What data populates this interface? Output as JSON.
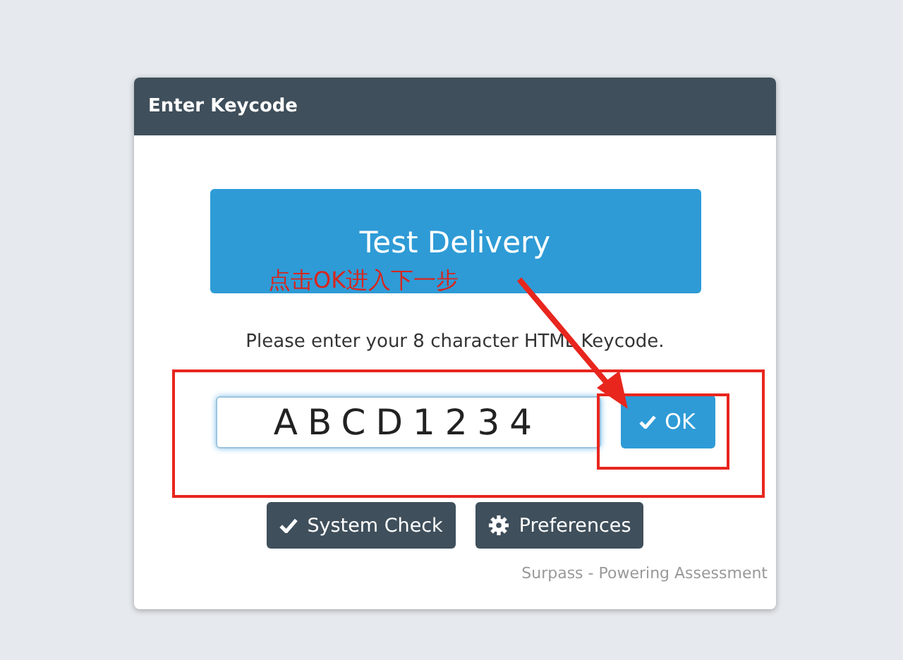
{
  "dialog": {
    "title": "Enter Keycode"
  },
  "delivery_button": {
    "label": "Test Delivery"
  },
  "instruction": "Please enter your 8 character HTML Keycode.",
  "keycode_field": {
    "value": "ABCD1234"
  },
  "ok_button": {
    "label": "OK"
  },
  "buttons": [
    {
      "kind": "check",
      "label": "System Check"
    },
    {
      "kind": "gear",
      "label": "Preferences"
    }
  ],
  "footer": "Surpass - Powering Assessment",
  "annotation": {
    "text": "点击OK进入下一步"
  }
}
